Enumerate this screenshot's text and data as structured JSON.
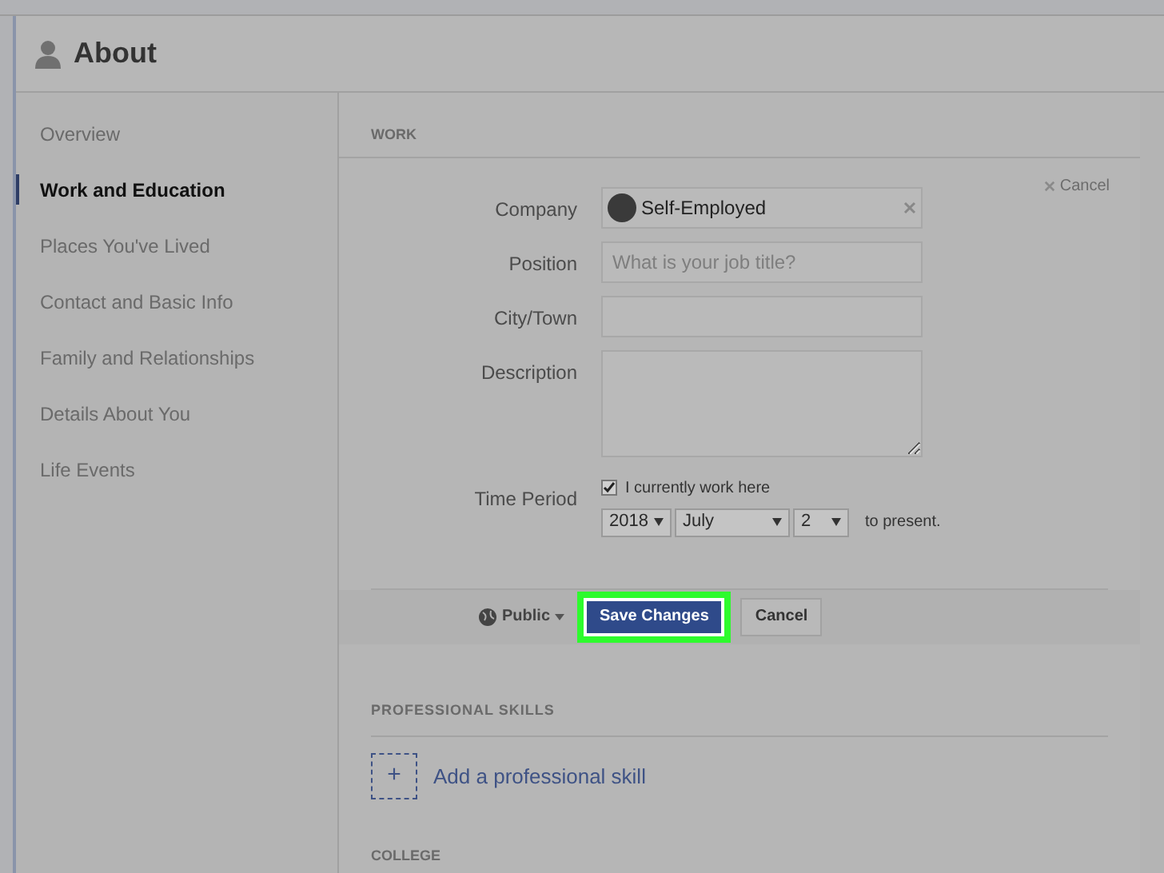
{
  "header": {
    "title": "About"
  },
  "sidebar": {
    "items": [
      {
        "label": "Overview",
        "selected": false
      },
      {
        "label": "Work and Education",
        "selected": true
      },
      {
        "label": "Places You've Lived",
        "selected": false
      },
      {
        "label": "Contact and Basic Info",
        "selected": false
      },
      {
        "label": "Family and Relationships",
        "selected": false
      },
      {
        "label": "Details About You",
        "selected": false
      },
      {
        "label": "Life Events",
        "selected": false
      }
    ]
  },
  "work": {
    "heading": "WORK",
    "cancel": "Cancel",
    "company": {
      "label": "Company",
      "value": "Self-Employed"
    },
    "position": {
      "label": "Position",
      "placeholder": "What is your job title?"
    },
    "city": {
      "label": "City/Town"
    },
    "description": {
      "label": "Description"
    },
    "time_period": {
      "label": "Time Period",
      "checkbox": {
        "label": "I currently work here",
        "checked": true
      },
      "year": "2018",
      "month": "July",
      "day": "2",
      "suffix": "to present."
    },
    "footer": {
      "audience": "Public",
      "save": "Save Changes",
      "cancel": "Cancel"
    }
  },
  "skills": {
    "heading": "PROFESSIONAL SKILLS",
    "add": "+",
    "add_label": "Add a professional skill"
  },
  "college": {
    "heading": "COLLEGE"
  }
}
